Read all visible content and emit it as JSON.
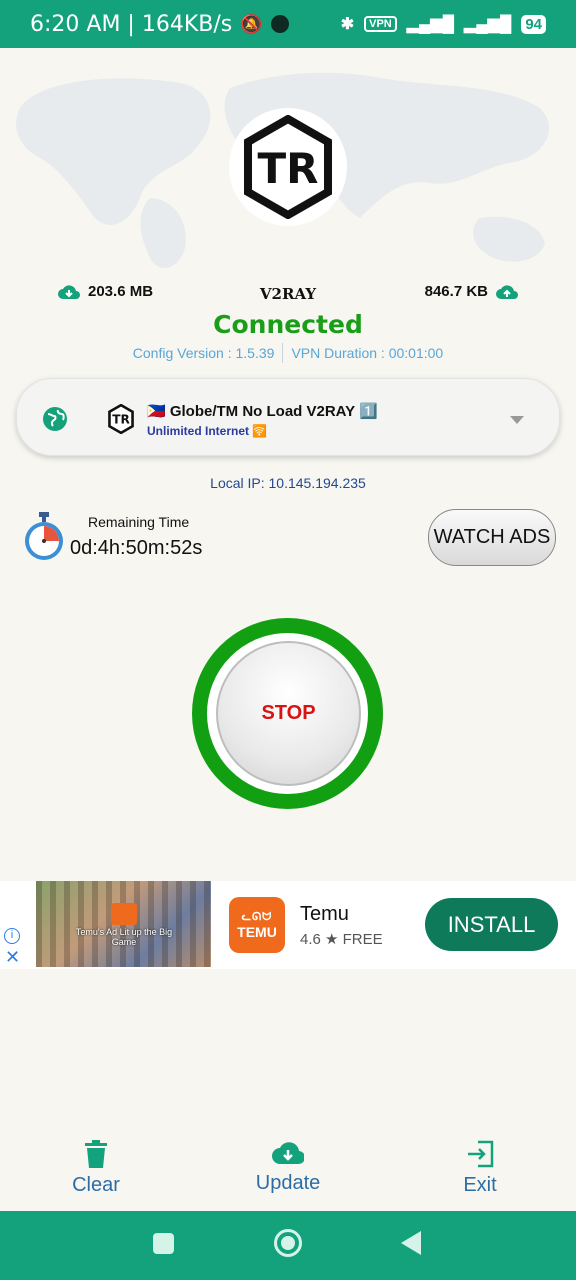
{
  "status_bar": {
    "time": "6:20 AM | 164KB/s",
    "vpn": "VPN",
    "battery": "94"
  },
  "stats": {
    "download": "203.6 MB",
    "protocol": "V2RAY",
    "upload": "846.7 KB"
  },
  "connection": {
    "status": "Connected",
    "config_version": "Config Version : 1.5.39",
    "duration": "VPN Duration : 00:01:00"
  },
  "server": {
    "name": "🇵🇭 Globe/TM No Load V2RAY 1️⃣",
    "subtitle": "Unlimited Internet 🛜"
  },
  "local_ip": "Local IP: 10.145.194.235",
  "remaining": {
    "label": "Remaining Time",
    "value": "0d:4h:50m:52s"
  },
  "watch_ads_label": "WATCH ADS",
  "stop_label": "STOP",
  "ad": {
    "caption": "Temu's Ad Lit up the Big Game",
    "logo_top": "ᓚᘏᗢ",
    "logo_text": "TEMU",
    "app_name": "Temu",
    "rating": "4.6 ★ FREE",
    "install_label": "INSTALL"
  },
  "tools": {
    "clear": "Clear",
    "update": "Update",
    "exit": "Exit"
  },
  "colors": {
    "brand_green": "#14a27c",
    "connected": "#1a9e1a",
    "stop_red": "#d81313",
    "ring_green": "#12a012"
  }
}
